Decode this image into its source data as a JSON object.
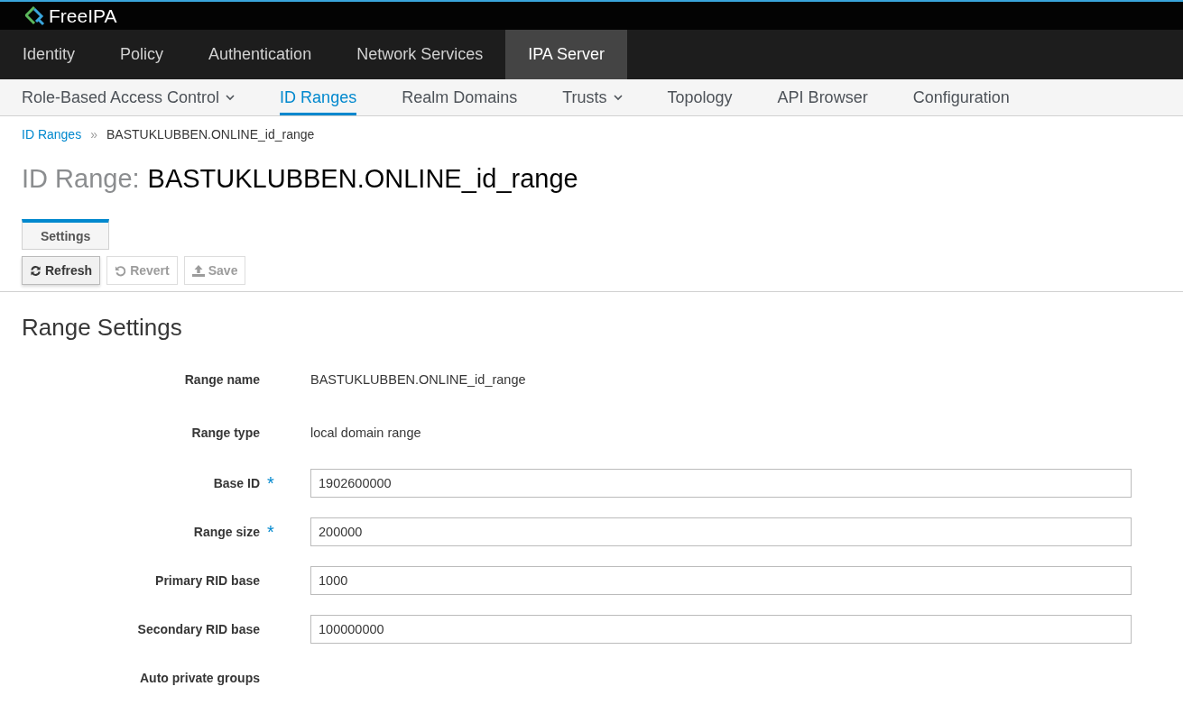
{
  "brand": {
    "name": "FreeIPA"
  },
  "main_nav": [
    {
      "label": "Identity",
      "selected": false
    },
    {
      "label": "Policy",
      "selected": false
    },
    {
      "label": "Authentication",
      "selected": false
    },
    {
      "label": "Network Services",
      "selected": false
    },
    {
      "label": "IPA Server",
      "selected": true
    }
  ],
  "sub_nav": [
    {
      "label": "Role-Based Access Control",
      "selected": false,
      "dropdown": true
    },
    {
      "label": "ID Ranges",
      "selected": true,
      "dropdown": false
    },
    {
      "label": "Realm Domains",
      "selected": false,
      "dropdown": false
    },
    {
      "label": "Trusts",
      "selected": false,
      "dropdown": true
    },
    {
      "label": "Topology",
      "selected": false,
      "dropdown": false
    },
    {
      "label": "API Browser",
      "selected": false,
      "dropdown": false
    },
    {
      "label": "Configuration",
      "selected": false,
      "dropdown": false
    }
  ],
  "breadcrumb": {
    "link": "ID Ranges",
    "separator": "»",
    "current": "BASTUKLUBBEN.ONLINE_id_range"
  },
  "title": {
    "prefix": "ID Range:",
    "name": "BASTUKLUBBEN.ONLINE_id_range"
  },
  "tabs": [
    {
      "label": "Settings",
      "selected": true
    }
  ],
  "actions": [
    {
      "kind": "refresh",
      "label": "Refresh",
      "disabled": false
    },
    {
      "kind": "revert",
      "label": "Revert",
      "disabled": true
    },
    {
      "kind": "save",
      "label": "Save",
      "disabled": true
    }
  ],
  "section": {
    "title": "Range Settings",
    "fields": [
      {
        "label": "Range name",
        "kind": "text",
        "value": "BASTUKLUBBEN.ONLINE_id_range"
      },
      {
        "label": "Range type",
        "kind": "text",
        "value": "local domain range"
      },
      {
        "label": "Base ID",
        "kind": "input",
        "value": "1902600000",
        "required_marker": "*"
      },
      {
        "label": "Range size",
        "kind": "input",
        "value": "200000",
        "required_marker": "*"
      },
      {
        "label": "Primary RID base",
        "kind": "input",
        "value": "1000"
      },
      {
        "label": "Secondary RID base",
        "kind": "input",
        "value": "100000000"
      },
      {
        "label": "Auto private groups",
        "kind": "empty"
      }
    ]
  }
}
